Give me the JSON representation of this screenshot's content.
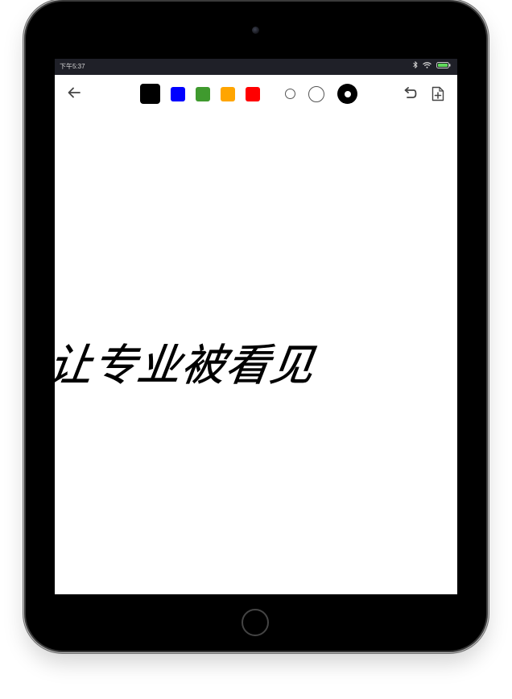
{
  "status_bar": {
    "time": "下午5:37",
    "icons": [
      "bluetooth-icon",
      "wifi-icon",
      "battery-icon"
    ],
    "battery_color": "#5fd85a"
  },
  "toolbar": {
    "back_icon": "arrow-left-icon",
    "colors": [
      {
        "name": "black",
        "hex": "#000000",
        "selected": true
      },
      {
        "name": "blue",
        "hex": "#0000ff",
        "selected": false
      },
      {
        "name": "green",
        "hex": "#3f9a2e",
        "selected": false
      },
      {
        "name": "orange",
        "hex": "#ffa500",
        "selected": false
      },
      {
        "name": "red",
        "hex": "#ff0000",
        "selected": false
      }
    ],
    "brush_sizes": [
      "small",
      "medium",
      "large"
    ],
    "selected_brush_size": "large",
    "undo_icon": "undo-icon",
    "new_page_icon": "new-page-icon"
  },
  "canvas": {
    "handwriting_text": "让专业被看见",
    "ink_color": "#000000"
  }
}
